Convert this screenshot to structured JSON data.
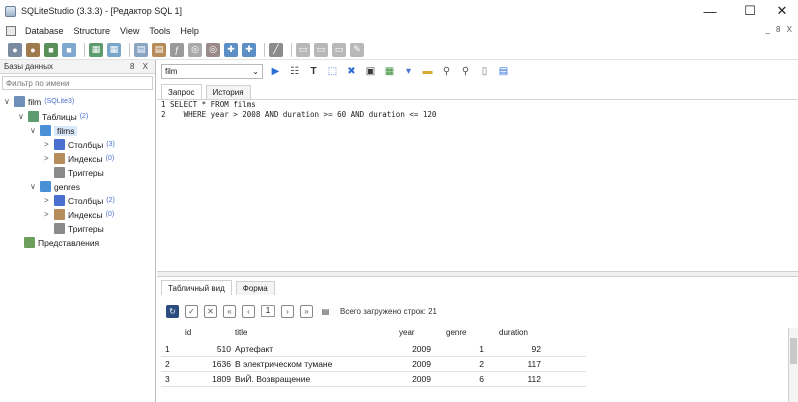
{
  "window": {
    "title": "SQLiteStudio (3.3.3) - [Редактор SQL 1]",
    "controls": {
      "minimize": "—",
      "maximize": "☐",
      "close": "✕"
    }
  },
  "menu": {
    "items": [
      "Database",
      "Structure",
      "View",
      "Tools",
      "Help"
    ],
    "mdi_controls": "_ 8 X"
  },
  "db_panel": {
    "title": "Базы данных",
    "controls": "8 X",
    "filter_placeholder": "Фильтр по имени",
    "tree": [
      {
        "label": "film",
        "count": "(SQLite3)"
      },
      {
        "label": "Таблицы",
        "count": "(2)"
      },
      {
        "label": "films",
        "count": ""
      },
      {
        "label": "Столбцы",
        "count": "(3)"
      },
      {
        "label": "Индексы",
        "count": "(0)"
      },
      {
        "label": "Триггеры",
        "count": ""
      },
      {
        "label": "genres",
        "count": ""
      },
      {
        "label": "Столбцы",
        "count": "(2)"
      },
      {
        "label": "Индексы",
        "count": "(0)"
      },
      {
        "label": "Триггеры",
        "count": ""
      },
      {
        "label": "Представления",
        "count": ""
      }
    ]
  },
  "editor": {
    "db_selected": "film",
    "tabs": [
      "Запрос",
      "История"
    ],
    "code_lines": [
      "1 SELECT * FROM films",
      "2    WHERE year > 2008 AND duration >= 60 AND duration <= 120"
    ]
  },
  "results": {
    "tabs": [
      "Табличный вид",
      "Форма"
    ],
    "page": "1",
    "row_count_text": "Всего загружено строк: 21",
    "columns": [
      "id",
      "title",
      "year",
      "genre",
      "duration"
    ],
    "rows": [
      {
        "n": "1",
        "id": "510",
        "title": "Артефакт",
        "year": "2009",
        "genre": "1",
        "duration": "92"
      },
      {
        "n": "2",
        "id": "1636",
        "title": "В электрическом тумане",
        "year": "2009",
        "genre": "2",
        "duration": "117"
      },
      {
        "n": "3",
        "id": "1809",
        "title": "ВиЙ. Возвращение",
        "year": "2009",
        "genre": "6",
        "duration": "112"
      }
    ]
  },
  "colors": {
    "selection": "#d9e8fb",
    "accent_blue": "#2f6fd6",
    "db_icon": "#4a90d9"
  },
  "icons": [
    "app-icon",
    "connect-icon",
    "disconnect-icon",
    "table-icon",
    "index-icon",
    "execute-icon",
    "explain-icon",
    "format-icon",
    "history-icon",
    "search-icon",
    "folder-icon",
    "tree-collapse-icon",
    "tree-expand-icon"
  ]
}
